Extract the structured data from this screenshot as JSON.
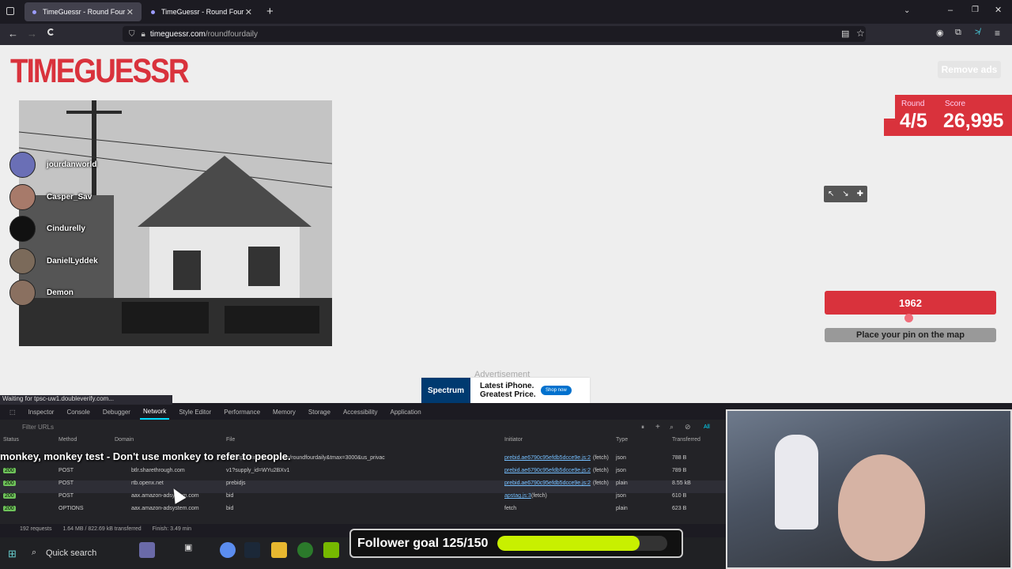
{
  "browser": {
    "tabs": [
      {
        "title": "TimeGuessr - Round Four",
        "active": true
      },
      {
        "title": "TimeGuessr - Round Four",
        "active": false
      }
    ],
    "url_domain": "timeguessr.com",
    "url_path": "/roundfourdaily"
  },
  "page": {
    "logo": "TIMEGUESSR",
    "remove_ads": "Remove ads",
    "round_label": "Round",
    "score_label": "Score",
    "round_value": "4/5",
    "score_value": "26,995",
    "year": "1962",
    "year_slider_fraction": 0.49,
    "pin_button": "Place your pin on the map",
    "ad_label": "Advertisement",
    "ad": {
      "brand": "Spectrum",
      "text": "Latest iPhone. Greatest Price.",
      "cta": "Shop now"
    },
    "streamers": [
      "jourdanworld",
      "Casper_Sav",
      "Cindurelly",
      "DanielLyddek",
      "Demon"
    ]
  },
  "status_bar": "Waiting for tpsc-uw1.doubleverify.com...",
  "devtools": {
    "tabs": [
      "Inspector",
      "Console",
      "Debugger",
      "Network",
      "Style Editor",
      "Performance",
      "Memory",
      "Storage",
      "Accessibility",
      "Application"
    ],
    "active_tab": "Network",
    "filter_placeholder": "Filter URLs",
    "filter_all": "All",
    "columns": [
      "Status",
      "Method",
      "Domain",
      "File",
      "Initiator",
      "Type",
      "Transferred"
    ],
    "rows": [
      {
        "status": "200",
        "method": "POST",
        "domain": "btlr.sharethrough.com",
        "file": "v1?supply_id=WYu2BXv1",
        "initiator": "prebid.ae6790c95efdb5dcce9e.js:2",
        "init_kind": "(fetch)",
        "type": "json",
        "transferred": "789 B"
      },
      {
        "status": "200",
        "method": "POST",
        "domain": "rtb.openx.net",
        "file": "prebidjs",
        "initiator": "prebid.ae6790c95efdb5dcce9e.js:2",
        "init_kind": "(fetch)",
        "type": "plain",
        "transferred": "8.55 kB"
      },
      {
        "status": "200",
        "method": "POST",
        "domain": "aax.amazon-adsystem.com",
        "file": "bid",
        "initiator": "apstag.js:3",
        "init_kind": "(fetch)",
        "type": "json",
        "transferred": "610 B"
      },
      {
        "status": "200",
        "method": "OPTIONS",
        "domain": "aax.amazon-adsystem.com",
        "file": "bid",
        "initiator": "",
        "init_kind": "fetch",
        "type": "plain",
        "transferred": "623 B"
      }
    ],
    "top_row": {
      "file": "er=https://timeguessr.com/roundfourdaily&tmax=3000&us_privac",
      "initiator": "prebid.ae6790c95efdb5dcce9e.js:2",
      "init_kind": "(fetch)",
      "type": "json",
      "transferred": "788 B"
    },
    "footer": {
      "requests": "192 requests",
      "transfer": "1.64 MB / 822.69 kB transferred",
      "finish": "Finish: 3.49 min"
    }
  },
  "chat_overlay": "monkey, monkey test - Don't use monkey to refer to people.",
  "taskbar": {
    "search": "Quick search"
  },
  "follower_goal": {
    "label": "Follower goal 125/150",
    "fraction": 0.833
  }
}
